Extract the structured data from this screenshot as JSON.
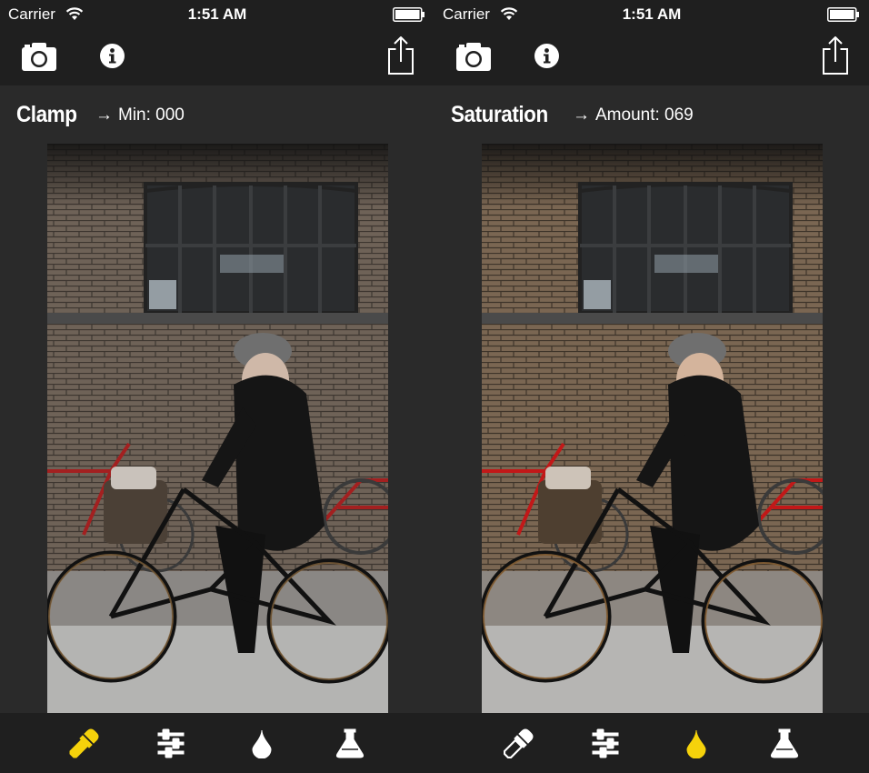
{
  "colors": {
    "accent": "#f5d20b",
    "icon_default": "#ffffff",
    "bar_background": "#1f1f1f",
    "content_background": "#2a2a2a"
  },
  "screens": [
    {
      "status": {
        "carrier": "Carrier",
        "time": "1:51 AM"
      },
      "nav": {
        "icons": [
          "camera-icon",
          "info-icon",
          "share-icon"
        ]
      },
      "filter": {
        "name": "Clamp",
        "param_arrow": "→",
        "param_text": "Min: 000"
      },
      "tabs": [
        {
          "icon": "eyedropper-icon",
          "active": true
        },
        {
          "icon": "sliders-icon",
          "active": false
        },
        {
          "icon": "drop-icon",
          "active": false
        },
        {
          "icon": "flask-icon",
          "active": false
        }
      ]
    },
    {
      "status": {
        "carrier": "Carrier",
        "time": "1:51 AM"
      },
      "nav": {
        "icons": [
          "camera-icon",
          "info-icon",
          "share-icon"
        ]
      },
      "filter": {
        "name": "Saturation",
        "param_arrow": "→",
        "param_text": "Amount: 069"
      },
      "tabs": [
        {
          "icon": "eyedropper-icon",
          "active": false
        },
        {
          "icon": "sliders-icon",
          "active": false
        },
        {
          "icon": "drop-icon",
          "active": true
        },
        {
          "icon": "flask-icon",
          "active": false
        }
      ]
    }
  ]
}
